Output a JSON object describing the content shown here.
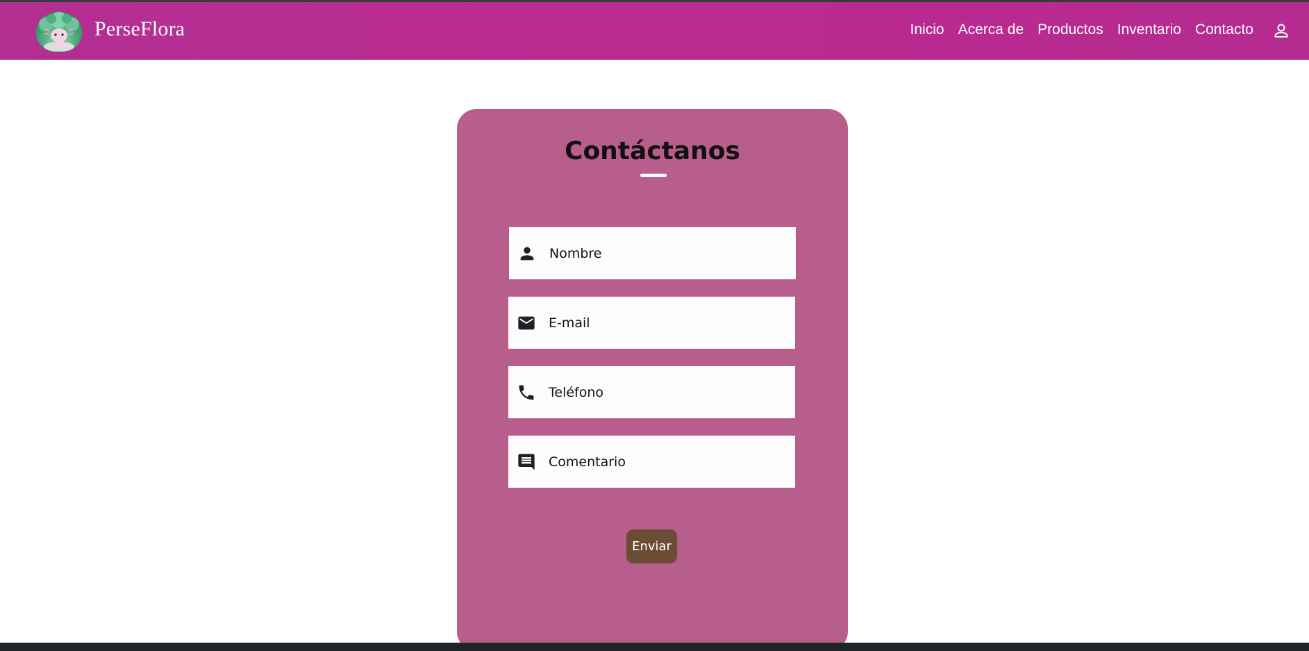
{
  "brand": {
    "name": "PerseFlora",
    "logo_icon": "axolotl-logo-icon"
  },
  "nav": {
    "items": [
      {
        "label": "Inicio"
      },
      {
        "label": "Acerca de"
      },
      {
        "label": "Productos"
      },
      {
        "label": "Inventario"
      },
      {
        "label": "Contacto"
      }
    ],
    "account_icon": "user-icon"
  },
  "form": {
    "title": "Contáctanos",
    "fields": [
      {
        "placeholder": "Nombre",
        "icon": "person-icon",
        "value": ""
      },
      {
        "placeholder": "E-mail",
        "icon": "mail-icon",
        "value": ""
      },
      {
        "placeholder": "Teléfono",
        "icon": "phone-icon",
        "value": ""
      },
      {
        "placeholder": "Comentario",
        "icon": "comment-icon",
        "value": ""
      }
    ],
    "submit_label": "Enviar"
  },
  "colors": {
    "navbar": "#bb2a8f",
    "card": "#b85e8c",
    "button": "#6b4d35"
  }
}
